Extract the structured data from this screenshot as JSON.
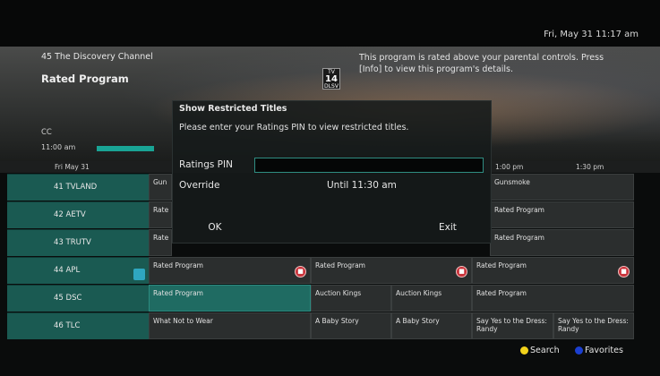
{
  "header": {
    "datetime": "Fri, May 31 11:17 am"
  },
  "info": {
    "channel": "45 The Discovery Channel",
    "title": "Rated Program",
    "rating_badge": {
      "top": "TV",
      "main": "14",
      "sub": "DLSV"
    },
    "message": "This program is rated above your parental controls. Press [Info] to view this program's details.",
    "cc": "CC",
    "start_time": "11:00 am",
    "progress": 1.0
  },
  "timeline": {
    "date": "Fri May 31",
    "t1": "1:00 pm",
    "t2": "1:30 pm"
  },
  "channels": [
    {
      "label": "41  TVLAND"
    },
    {
      "label": "42  AETV"
    },
    {
      "label": "43  TRUTV"
    },
    {
      "label": "44  APL"
    },
    {
      "label": "45  DSC"
    },
    {
      "label": "46  TLC"
    }
  ],
  "grid": {
    "row41": [
      "Gun",
      "Gunsmoke"
    ],
    "row42": [
      "Rate",
      "Rated Program"
    ],
    "row43": [
      "Rate",
      "Rated Program"
    ],
    "row44": [
      "Rated Program",
      "Rated Program",
      "Rated Program"
    ],
    "row45": [
      "Rated Program",
      "Auction Kings",
      "Auction Kings",
      "Rated Program"
    ],
    "row46": [
      "What Not to Wear",
      "A Baby Story",
      "A Baby Story",
      "Say Yes to the Dress: Randy",
      "Say Yes to the Dress: Randy"
    ]
  },
  "dialog": {
    "title": "Show Restricted Titles",
    "message": "Please enter your Ratings PIN to view restricted titles.",
    "pin_label": "Ratings PIN",
    "pin_value": "",
    "override_label": "Override",
    "override_value": "Until 11:30 am",
    "ok_label": "OK",
    "exit_label": "Exit"
  },
  "footer": {
    "search_label": "Search",
    "favorites_label": "Favorites"
  },
  "colors": {
    "accent": "#19a495",
    "search_key": "#f2d21b",
    "favorites_key": "#1b3fd0",
    "lock": "#c9323a"
  },
  "icons": {
    "lock": "lock-icon",
    "favorite": "favorite-channel-icon"
  }
}
